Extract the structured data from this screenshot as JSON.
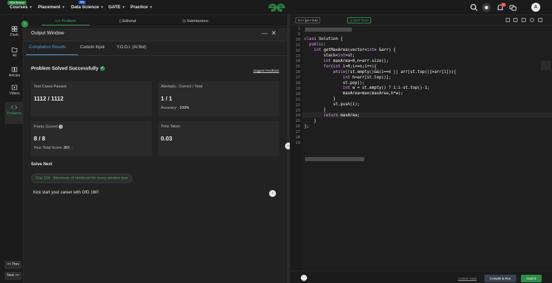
{
  "topnav": {
    "promo": "90% Refund",
    "courses": "Courses",
    "placement": "Placement",
    "ibm": "IBM",
    "data_science": "Data Science",
    "gate": "GATE",
    "practice": "Practice",
    "notification_count": "32",
    "avatar_letter": "A"
  },
  "sidebar": {
    "items": [
      {
        "label": "Dash"
      },
      {
        "label": "All"
      },
      {
        "label": "Articles"
      },
      {
        "label": "Videos"
      },
      {
        "label": "Problems"
      }
    ],
    "prev": "<< Prev",
    "next": "Next >>"
  },
  "problem_tabs": {
    "problem": "Problem",
    "editorial": "Editorial",
    "submissions": "Submissions"
  },
  "output_window": {
    "title": "Output Window",
    "tabs": [
      "Compilation Results",
      "Custom Input",
      "Y.O.G.I. (AI Bot)"
    ],
    "status": "Problem Solved Successfully",
    "feedback": "Suggest Feedback",
    "test_cases_label": "Test Cases Passed",
    "test_cases_value": "1112 / 1112",
    "attempts_label": "Attempts : Correct / Total",
    "attempts_value": "1 / 1",
    "accuracy_label": "Accuracy :",
    "accuracy_value": "100%",
    "points_label": "Points Scored",
    "points_value": "8 / 8",
    "total_score_label": "Your Total Score:",
    "total_score_value": "361",
    "time_label": "Time Taken",
    "time_value": "0.03",
    "solve_next": "Solve Next",
    "pill": "Day 104 - Maximum of minimum for every window size",
    "kick": "Kick start your career with GfG 160!"
  },
  "editor": {
    "language": "C++ (g++ 5.4)",
    "timer": "Start Timer",
    "line_numbers": [
      "1",
      "9",
      "10",
      "11",
      "12",
      "13",
      "14",
      "15",
      "16",
      "17",
      "18",
      "19",
      "20",
      "21",
      "22",
      "23",
      "24",
      "25",
      "26",
      "27",
      "28",
      "29"
    ],
    "lines": [
      "",
      "",
      "class Solution {",
      "  public:",
      "    int getMaxArea(vector<int> &arr) {",
      "        stack<int>st;",
      "        int maxArea=0,n=arr.size();",
      "        for(int i=0;i<=n;i++){",
      "            while(!st.empty()&&(i==n || arr[st.top()]>arr[i])){",
      "                int h=arr[st.top()];",
      "                st.pop();",
      "                int w = st.empty() ? i:i-st.top()-1;",
      "                maxArea=max(maxArea,h*w);",
      "            }",
      "            st.push(i);",
      "        }",
      "        return maxArea;",
      "    }",
      "};",
      "",
      "",
      ""
    ],
    "custom_input": "Custom Input",
    "compile_run": "Compile & Run",
    "submit": "Submit"
  }
}
